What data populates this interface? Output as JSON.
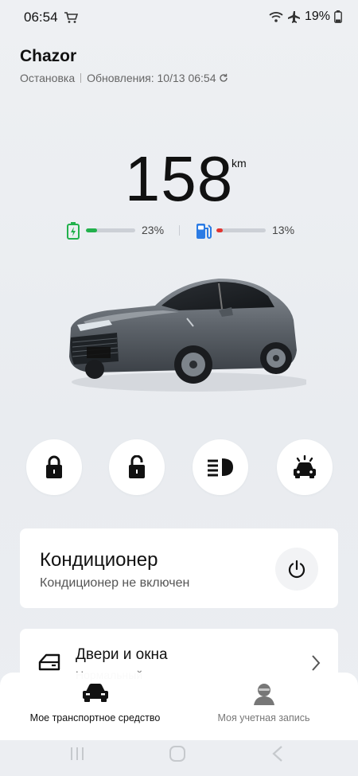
{
  "status_bar": {
    "time": "06:54",
    "battery": "19%"
  },
  "header": {
    "vehicle_name": "Chazor",
    "state": "Остановка",
    "updated": "Обновления: 10/13 06:54"
  },
  "range": {
    "value": "158",
    "unit": "km"
  },
  "battery_level": {
    "percent_label": "23%",
    "fraction": 0.23,
    "color": "#22b14c"
  },
  "fuel_level": {
    "percent_label": "13%",
    "fraction": 0.13,
    "color": "#e3342f"
  },
  "quick_actions": [
    {
      "name": "lock",
      "icon": "lock-closed-icon"
    },
    {
      "name": "unlock",
      "icon": "lock-open-icon"
    },
    {
      "name": "headlights",
      "icon": "headlight-icon"
    },
    {
      "name": "find-car",
      "icon": "car-alarm-icon"
    }
  ],
  "climate": {
    "title": "Кондиционер",
    "status": "Кондиционер не включен"
  },
  "doors": {
    "title": "Двери и окна",
    "status": "Нормальный"
  },
  "bottom_nav": {
    "my_vehicle": "Мое транспортное средство",
    "my_account": "Моя учетная запись"
  },
  "colors": {
    "accent_text": "#111111",
    "card_bg": "#ffffff",
    "page_bg": "#eceef2"
  }
}
